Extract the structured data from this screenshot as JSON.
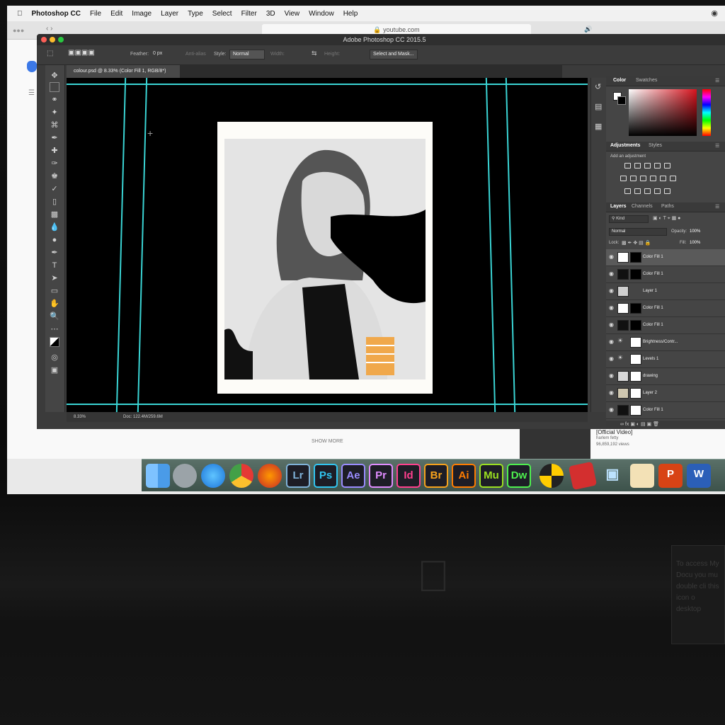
{
  "menubar": {
    "app_name": "Photoshop CC",
    "items": [
      "File",
      "Edit",
      "Image",
      "Layer",
      "Type",
      "Select",
      "Filter",
      "3D",
      "View",
      "Window",
      "Help"
    ]
  },
  "safari": {
    "url": "youtube.com"
  },
  "youtube": {
    "show_more": "SHOW MORE",
    "video_title": "[Official Video]",
    "channel": "harlem fetty",
    "views": "96,859,192 views"
  },
  "photoshop": {
    "window_title": "Adobe Photoshop CC 2015.5",
    "options": {
      "feather_label": "Feather:",
      "feather_value": "0 px",
      "antialias": "Anti-alias",
      "style_label": "Style:",
      "style_value": "Normal",
      "width_label": "Width:",
      "height_label": "Height:",
      "select_mask": "Select and Mask..."
    },
    "document_tab": "colour.psd @ 8.33% (Color Fill 1, RGB/8*)",
    "status": {
      "zoom": "8.33%",
      "doc": "Doc: 122.4M/259.6M"
    }
  },
  "panels": {
    "color_tabs": [
      "Color",
      "Swatches"
    ],
    "adjust_tabs": [
      "Adjustments",
      "Styles"
    ],
    "add_adjustment": "Add an adjustment",
    "layer_tabs": [
      "Layers",
      "Channels",
      "Paths"
    ],
    "kind": "Kind",
    "blend_mode": "Normal",
    "opacity_label": "Opacity:",
    "opacity_value": "100%",
    "lock_label": "Lock:",
    "fill_label": "Fill:",
    "fill_value": "100%",
    "layers": [
      {
        "name": "Color Fill 1",
        "thumb": "#ffffff",
        "mask": "#000000"
      },
      {
        "name": "Color Fill 1",
        "thumb": "#111111",
        "mask": "#000000"
      },
      {
        "name": "Layer 1",
        "thumb": "#cfcfcf",
        "mask": ""
      },
      {
        "name": "Color Fill 1",
        "thumb": "#ffffff",
        "mask": "#000000"
      },
      {
        "name": "Color Fill 1",
        "thumb": "#111111",
        "mask": "#000000"
      },
      {
        "name": "Brightness/Contr...",
        "thumb": "",
        "mask": "#ffffff"
      },
      {
        "name": "Levels 1",
        "thumb": "",
        "mask": "#ffffff"
      },
      {
        "name": "drawing",
        "thumb": "#d8d8d8",
        "mask": "#ffffff"
      },
      {
        "name": "Layer 2",
        "thumb": "#cfc7b0",
        "mask": "#ffffff"
      },
      {
        "name": "Color Fill 1",
        "thumb": "#111111",
        "mask": "#ffffff"
      }
    ]
  },
  "dock": {
    "apps": [
      {
        "label": "Lr",
        "color": "#7fb2d9"
      },
      {
        "label": "Ps",
        "color": "#31c5f0"
      },
      {
        "label": "Ae",
        "color": "#9a8cff"
      },
      {
        "label": "Pr",
        "color": "#e08cff"
      },
      {
        "label": "Id",
        "color": "#ff3f8e"
      },
      {
        "label": "Br",
        "color": "#f6a21c"
      },
      {
        "label": "Ai",
        "color": "#ff7c00"
      },
      {
        "label": "Mu",
        "color": "#9be021"
      },
      {
        "label": "Dw",
        "color": "#4ef04e"
      }
    ]
  },
  "sticker": {
    "text": "To access My Docu you mu double cli this icon o desktop"
  }
}
